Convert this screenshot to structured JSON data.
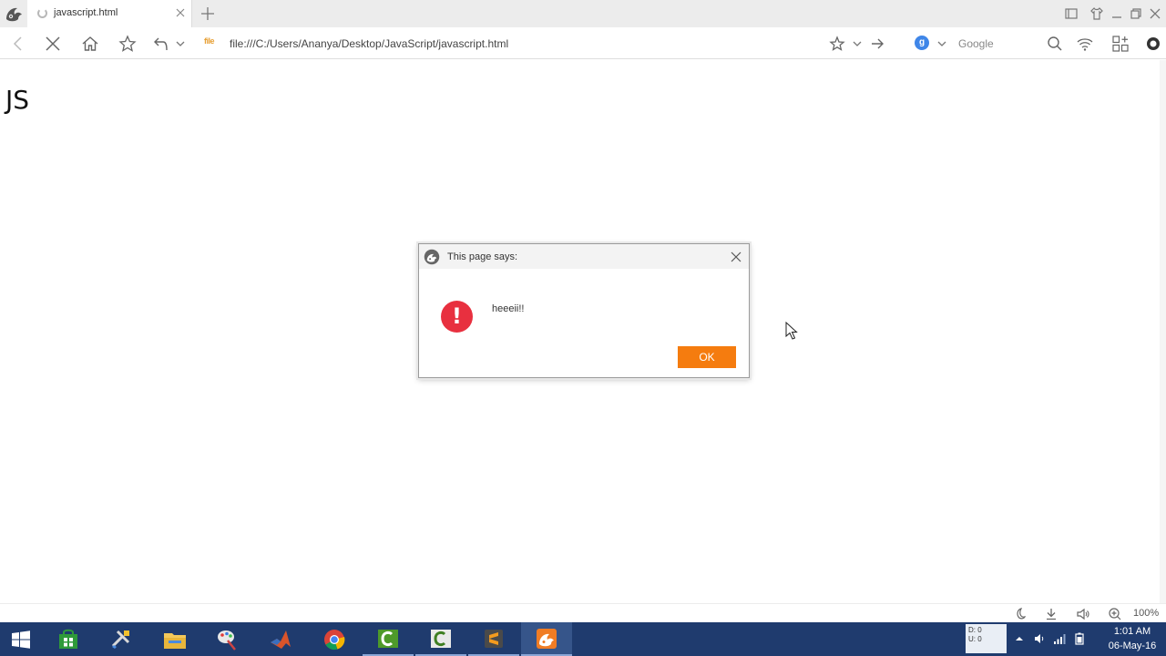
{
  "tab": {
    "title": "javascript.html"
  },
  "navbar": {
    "address_prefix": "file",
    "address": "file:///C:/Users/Ananya/Desktop/JavaScript/javascript.html",
    "search_engine_badge": "g",
    "search_placeholder": "Google"
  },
  "page": {
    "heading": "JS"
  },
  "dialog": {
    "title": "This page says:",
    "message": "heeeii!!",
    "ok_label": "OK",
    "alert_glyph": "!"
  },
  "statusbar": {
    "zoom": "100%"
  },
  "taskbar": {
    "apps": [
      "start-button",
      "store",
      "tools",
      "file-explorer",
      "paint",
      "matlab",
      "chrome",
      "camtasia",
      "camtasia-recorder",
      "sublime-text",
      "uc-browser"
    ],
    "net_meter": {
      "down": "D: 0",
      "up": "U: 0"
    },
    "time": "1:01 AM",
    "date": "06-May-16"
  },
  "colors": {
    "accent": "#f57c0f",
    "alert": "#e8303f",
    "taskbar": "#1f3b6e"
  }
}
